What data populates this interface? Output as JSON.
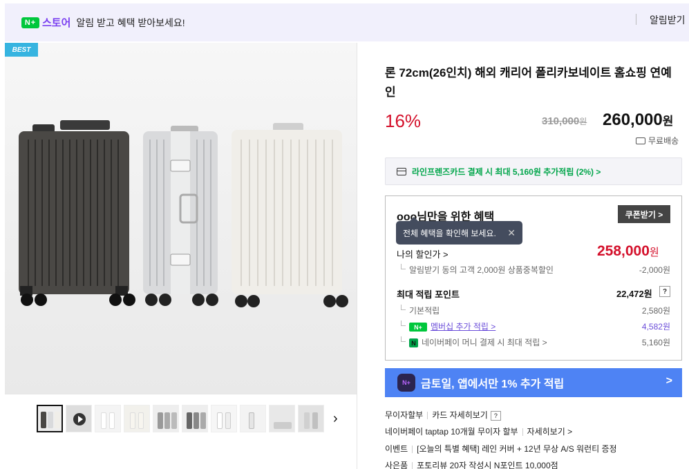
{
  "banner": {
    "logo_text": "N+",
    "store_label": "스토어",
    "message": "알림 받고 혜택 받아보세요!",
    "notify_button": "알림받기"
  },
  "gallery": {
    "badge": "BEST",
    "next_icon": "chevron-right-icon"
  },
  "product": {
    "title": "론 72cm(26인치) 해외 캐리어 폴리카보네이트 홈쇼핑 연예인",
    "discount_rate": "16%",
    "original_price": "310,000",
    "original_price_unit": "원",
    "sale_price": "260,000",
    "sale_price_unit": "원",
    "shipping": "무료배송"
  },
  "card_promo": {
    "text": "라인프렌즈카드 결제 시 최대 5,160원 추가적립 (2%) >"
  },
  "benefits": {
    "title": "ooo님만을 위한 혜택",
    "coupon_button": "쿠폰받기 >",
    "tooltip": "전체 혜택을 확인해 보세요.",
    "tooltip_close": "✕",
    "my_discount_label": "나의 할인가 >",
    "my_discount_price": "258,000",
    "my_discount_unit": "원",
    "discount_items": [
      {
        "label": "알림받기 동의 고객 2,000원 상품중복할인",
        "value": "-2,000원"
      }
    ],
    "points_label": "최대 적립 포인트",
    "points_value": "22,472원",
    "points_help": "?",
    "point_items": [
      {
        "label": "기본적립",
        "value": "2,580원"
      },
      {
        "label": "멤버십 추가 적립 >",
        "value": "4,582원"
      },
      {
        "label": "네이버페이 머니 결제 시 최대 적립 >",
        "value": "5,160원"
      }
    ]
  },
  "app_promo": {
    "icon_text": "N+",
    "text": "금토일, 앱에서만 1% 추가 적립",
    "arrow": ">"
  },
  "info": {
    "installment_label": "무이자할부",
    "card_detail": "카드 자세히보기",
    "help": "?",
    "naverpay_installment": "네이버페이 taptap 10개월 무이자 할부",
    "naverpay_detail": "자세히보기 >",
    "event_label": "이벤트",
    "event_text": "[오늘의 특별 혜택] 레인 커버 + 12년 무상 A/S 워런티 증정",
    "gift_label": "사은품",
    "gift_text": "포토리뷰 20자 작성시 N포인트 10,000점"
  },
  "colors": {
    "accent_red": "#d4102b",
    "naver_green": "#00c73c",
    "store_purple": "#7a3ff0",
    "promo_blue": "#4e83f4"
  }
}
